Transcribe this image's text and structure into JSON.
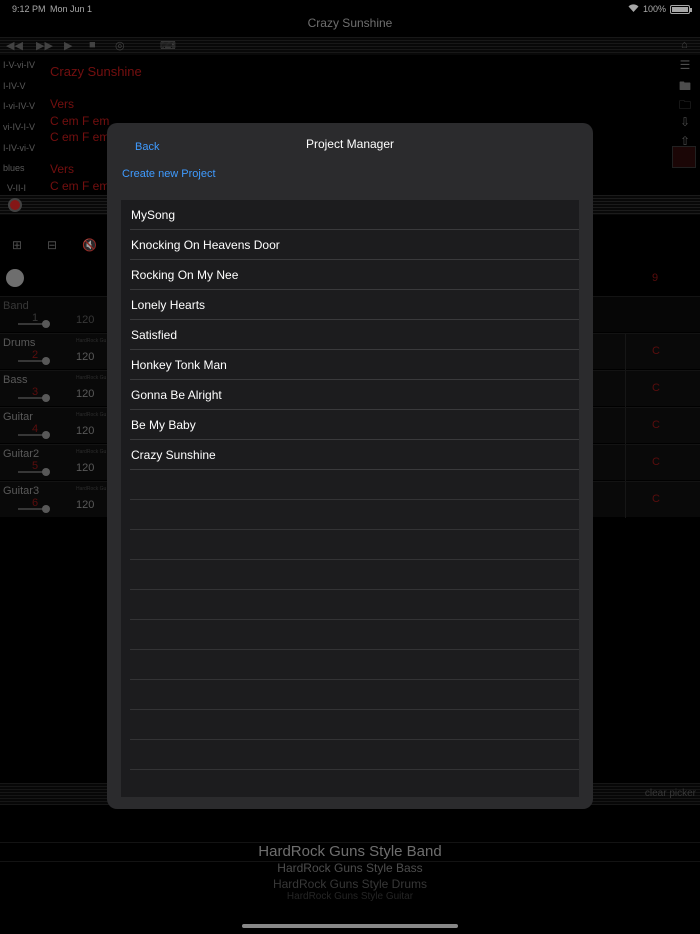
{
  "status": {
    "time": "9:12 PM",
    "date": "Mon Jun 1",
    "battery": "100%"
  },
  "app": {
    "title": "Crazy Sunshine"
  },
  "progressions": [
    "I-V-vi-IV",
    "I-IV-V",
    "I-vi-IV-V",
    "vi-IV-I-V",
    "I-IV-vi-V",
    "blues",
    "V-II-I"
  ],
  "song": {
    "title": "Crazy Sunshine",
    "section1": "Vers",
    "chords1": "C em F em",
    "chords2": "C em F em",
    "section2": "Vers",
    "chords3": "C em F em"
  },
  "tracks": {
    "band_label": "Band",
    "band_num": "1",
    "band_bpm": "120",
    "bar_number": "9",
    "items": [
      {
        "name": "Drums",
        "num": "2",
        "bpm": "120",
        "style": "HardRock Gu",
        "key": "C"
      },
      {
        "name": "Bass",
        "num": "3",
        "bpm": "120",
        "style": "HardRock Gu",
        "key": "C"
      },
      {
        "name": "Guitar",
        "num": "4",
        "bpm": "120",
        "style": "HardRock Gu",
        "key": "C"
      },
      {
        "name": "Guitar2",
        "num": "5",
        "bpm": "120",
        "style": "HardRock Gu",
        "key": "C"
      },
      {
        "name": "Guitar3",
        "num": "6",
        "bpm": "120",
        "style": "HardRock Gu",
        "key": "C"
      }
    ]
  },
  "clear_picker": "clear picker",
  "picker": [
    "HardRock Guns Style Band",
    "HardRock Guns Style Bass",
    "HardRock Guns Style Drums",
    "HardRock Guns Style Guitar"
  ],
  "modal": {
    "back_label": "Back",
    "title": "Project Manager",
    "create_label": "Create new Project",
    "projects": [
      "MySong",
      "Knocking On Heavens Door",
      "Rocking On My Nee",
      "Lonely Hearts",
      "Satisfied",
      "Honkey Tonk Man",
      "Gonna Be Alright",
      "Be My Baby",
      "Crazy Sunshine"
    ]
  }
}
